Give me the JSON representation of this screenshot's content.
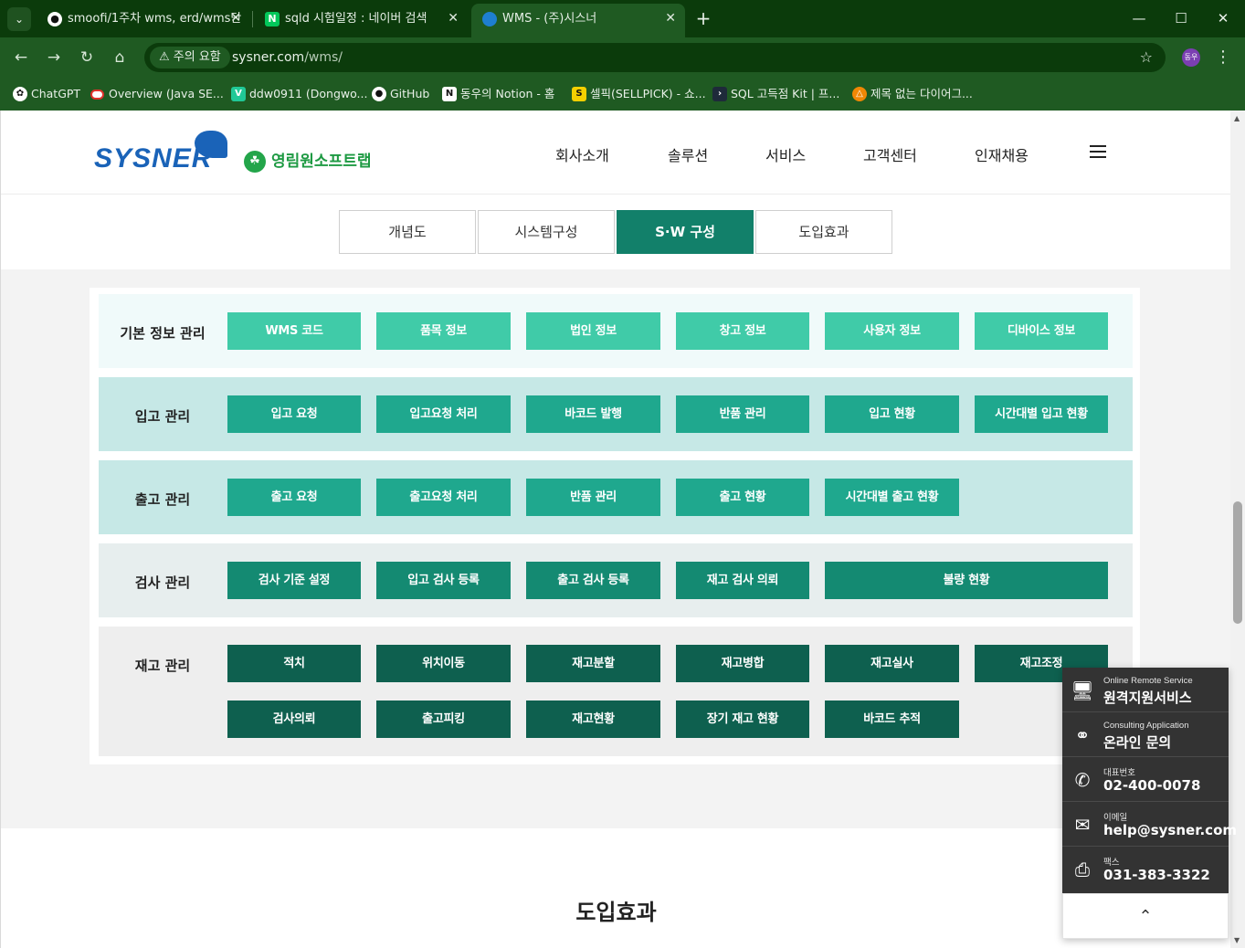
{
  "browser": {
    "tabs": [
      {
        "title": "smoofi/1주차 wms, erd/wms단",
        "icon": "github-icon"
      },
      {
        "title": "sqld 시험일정 : 네이버 검색",
        "icon": "naver-icon",
        "icon_text": "N"
      },
      {
        "title": "WMS - (주)시스너",
        "icon": "edge-icon"
      }
    ],
    "security_label": "주의 요함",
    "url_host": "sysner.com",
    "url_path": "/wms/",
    "profile_label": "동우",
    "bookmarks": [
      {
        "label": "ChatGPT",
        "icon": "openai-icon"
      },
      {
        "label": "Overview (Java SE...",
        "icon": "oracle-icon"
      },
      {
        "label": "ddw0911 (Dongwo...",
        "icon": "velog-icon",
        "icon_text": "V"
      },
      {
        "label": "GitHub",
        "icon": "github-icon"
      },
      {
        "label": "동우의 Notion - 홈",
        "icon": "notion-icon",
        "icon_text": "N"
      },
      {
        "label": "셀픽(SELLPICK) - 쇼...",
        "icon": "sellpick-icon",
        "icon_text": "S"
      },
      {
        "label": "SQL 고득점 Kit | 프...",
        "icon": "programmers-icon"
      },
      {
        "label": "제목 없는 다이어그...",
        "icon": "drawio-icon"
      }
    ]
  },
  "site": {
    "logo_main": "SYSNER",
    "logo_sub": "영림원소프트랩",
    "nav": [
      "회사소개",
      "솔루션",
      "서비스",
      "고객센터",
      "인재채용"
    ],
    "subtabs": [
      "개념도",
      "시스템구성",
      "S·W 구성",
      "도입효과"
    ],
    "active_subtab": 2,
    "rows": [
      {
        "label": "기본 정보 관리",
        "buttons": [
          "WMS 코드",
          "품목 정보",
          "법인 정보",
          "창고 정보",
          "사용자 정보",
          "디바이스 정보"
        ]
      },
      {
        "label": "입고 관리",
        "buttons": [
          "입고 요청",
          "입고요청 처리",
          "바코드 발행",
          "반품 관리",
          "입고 현황",
          "시간대별 입고 현황"
        ]
      },
      {
        "label": "출고 관리",
        "buttons": [
          "출고 요청",
          "출고요청 처리",
          "반품 관리",
          "출고 현황",
          "시간대별 출고 현황"
        ]
      },
      {
        "label": "검사 관리",
        "buttons": [
          "검사 기준 설정",
          "입고 검사 등록",
          "출고 검사 등록",
          "재고 검사 의뢰",
          "불량 현황"
        ]
      },
      {
        "label": "재고 관리",
        "buttons": [
          "적치",
          "위치이동",
          "재고분할",
          "재고병합",
          "재고실사",
          "재고조정",
          "검사의뢰",
          "출고피킹",
          "재고현황",
          "장기 재고 현황",
          "바코드 추적"
        ]
      }
    ],
    "colors": {
      "row_bg": [
        "#f0fafa",
        "#c6e8e6",
        "#c6e8e6",
        "#e7eeee",
        "#eeeeee"
      ],
      "btn": [
        "#40cba8",
        "#1fa88e",
        "#1fa88e",
        "#148a72",
        "#0e604f"
      ],
      "active_tab": "#12806a"
    },
    "section_title": "도입효과"
  },
  "float_panel": {
    "items": [
      {
        "small": "Online Remote Service",
        "big": "원격지원서비스",
        "icon": "monitor-icon"
      },
      {
        "small": "Consulting Application",
        "big": "온라인 문의",
        "icon": "headset-icon"
      },
      {
        "small": "대표번호",
        "big": "02-400-0078",
        "icon": "phone-icon"
      },
      {
        "small": "이메일",
        "big": "help@sysner.com",
        "icon": "mail-icon"
      },
      {
        "small": "팩스",
        "big": "031-383-3322",
        "icon": "fax-icon"
      }
    ],
    "top_icon": "chevron-up-icon"
  }
}
